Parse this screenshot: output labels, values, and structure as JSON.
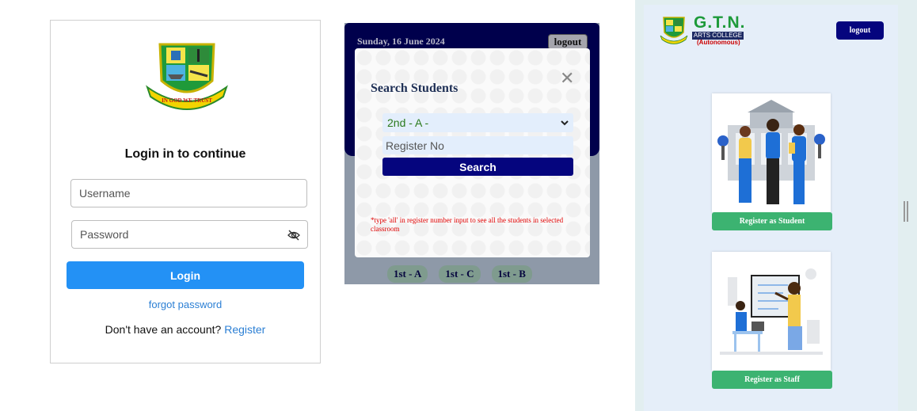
{
  "login": {
    "crest_motto": "IN GOD WE TRUST",
    "title": "Login in to continue",
    "username_placeholder": "Username",
    "password_placeholder": "Password",
    "login_label": "Login",
    "forgot_label": "forgot password",
    "no_account_text": "Don't have an account?",
    "register_label": "Register"
  },
  "search_panel": {
    "date": "Sunday, 16 June 2024",
    "logout_label": "logout",
    "modal": {
      "title": "Search Students",
      "close_icon": "close-icon",
      "class_selected": "2nd - A -",
      "register_placeholder": "Register No",
      "search_label": "Search",
      "note": "*type 'all' in register number input to see all the students in selected classroom"
    },
    "class_chips": [
      "1st - A",
      "1st - C",
      "1st - B"
    ]
  },
  "dashboard": {
    "logo_title": "G.T.N.",
    "logo_subtitle": "ARTS COLLEGE",
    "logo_tag": "(Autonomous)",
    "logout_label": "logout",
    "student_button": "Register as Student",
    "staff_button": "Register as Staff"
  },
  "colors": {
    "primary_blue": "#2391f5",
    "navy": "#05057e",
    "green": "#3cb371",
    "note_red": "#e00000"
  }
}
